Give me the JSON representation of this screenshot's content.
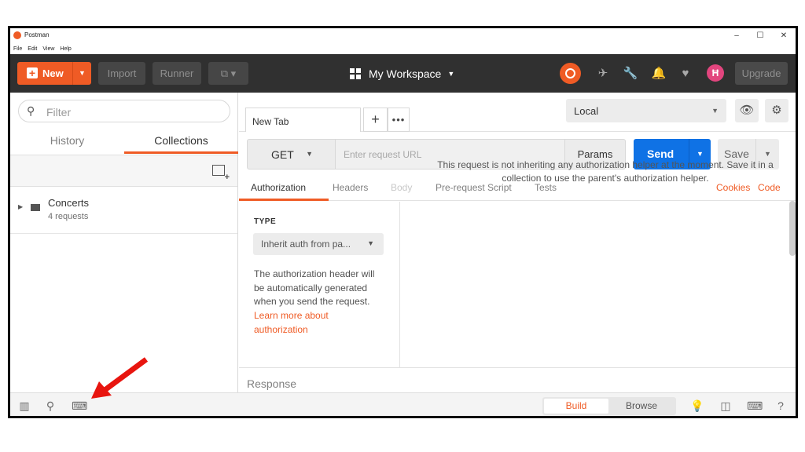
{
  "window": {
    "title": "Postman",
    "controls": [
      "–",
      "☐",
      "✕"
    ]
  },
  "menubar": [
    "File",
    "Edit",
    "View",
    "Help"
  ],
  "header": {
    "new_label": "New",
    "import_label": "Import",
    "runner_label": "Runner",
    "workspace_label": "My Workspace",
    "upgrade_label": "Upgrade",
    "icons": [
      "sync-icon",
      "satellite-icon",
      "wrench-icon",
      "bell-icon",
      "heart-icon",
      "avatar"
    ],
    "accent": "#ef5b25"
  },
  "sidebar": {
    "filter_placeholder": "Filter",
    "tabs": [
      {
        "label": "History",
        "active": false
      },
      {
        "label": "Collections",
        "active": true
      }
    ],
    "collections": [
      {
        "name": "Concerts",
        "count": "4 requests"
      }
    ]
  },
  "main": {
    "tab_label": "New Tab",
    "environment": "Local",
    "method": "GET",
    "url_placeholder": "Enter request URL",
    "params_label": "Params",
    "send_label": "Send",
    "save_label": "Save",
    "send_color": "#0f72e5",
    "sub_tabs": [
      {
        "label": "Authorization",
        "state": "active"
      },
      {
        "label": "Headers",
        "state": "normal"
      },
      {
        "label": "Body",
        "state": "disabled"
      },
      {
        "label": "Pre-request Script",
        "state": "normal"
      },
      {
        "label": "Tests",
        "state": "normal"
      }
    ],
    "cookies_label": "Cookies",
    "code_label": "Code",
    "auth": {
      "type_label": "TYPE",
      "type_value": "Inherit auth from pa...",
      "description": "The authorization header will be automatically generated when you send the request.",
      "learn_more": "Learn more about authorization",
      "message": "This request is not inheriting any authorization helper at the moment. Save it in a collection to use the parent's authorization helper."
    },
    "response_label": "Response"
  },
  "statusbar": {
    "build_label": "Build",
    "browse_label": "Browse"
  },
  "annotation": {
    "arrow_color": "#e8150f"
  }
}
